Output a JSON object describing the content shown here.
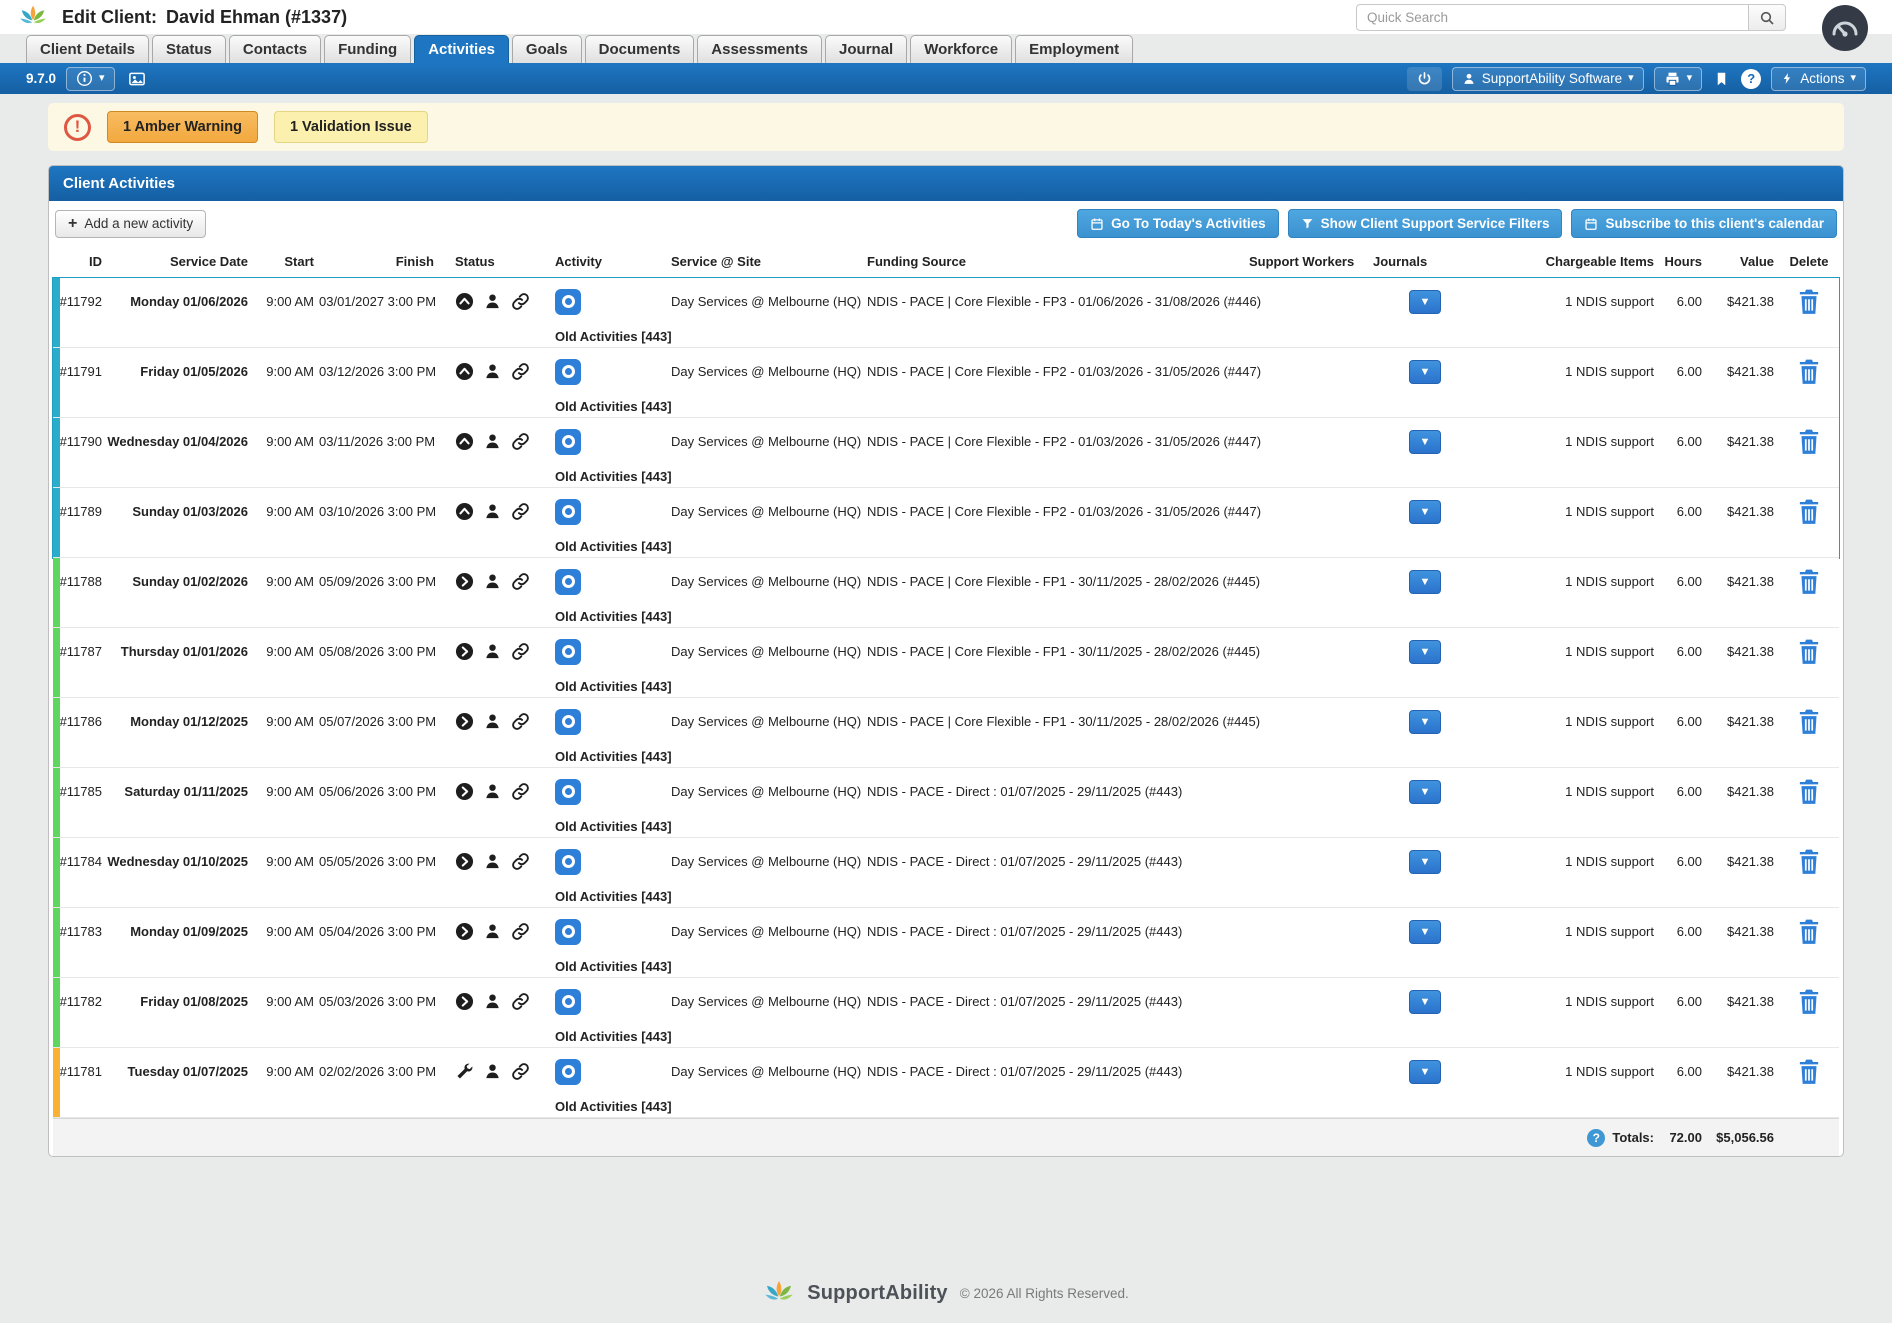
{
  "glyphs": {
    "caret_down": "▾",
    "dropdown_caret": "▼",
    "plus": "+",
    "question": "?",
    "exclamation": "!"
  },
  "header": {
    "title_prefix": "Edit Client:",
    "client_name": "David Ehman (#1337)",
    "search_placeholder": "Quick Search"
  },
  "tabs": [
    {
      "label": "Client Details",
      "active": false
    },
    {
      "label": "Status",
      "active": false
    },
    {
      "label": "Contacts",
      "active": false
    },
    {
      "label": "Funding",
      "active": false
    },
    {
      "label": "Activities",
      "active": true
    },
    {
      "label": "Goals",
      "active": false
    },
    {
      "label": "Documents",
      "active": false
    },
    {
      "label": "Assessments",
      "active": false
    },
    {
      "label": "Journal",
      "active": false
    },
    {
      "label": "Workforce",
      "active": false
    },
    {
      "label": "Employment",
      "active": false
    }
  ],
  "toolbar": {
    "version": "9.7.0",
    "user_menu_label": "SupportAbility Software",
    "actions_label": "Actions"
  },
  "warnings": {
    "amber_label": "1 Amber Warning",
    "validation_label": "1 Validation Issue"
  },
  "panel": {
    "title": "Client Activities",
    "add_button": "Add a new activity",
    "today_button": "Go To Today's Activities",
    "filters_button": "Show Client Support Service Filters",
    "subscribe_button": "Subscribe to this client's calendar"
  },
  "table": {
    "columns": [
      "ID",
      "Service Date",
      "Start",
      "Finish",
      "Status",
      "Activity",
      "Service @ Site",
      "Funding Source",
      "Support Workers",
      "Journals",
      "Chargeable Items",
      "Hours",
      "Value",
      "Delete"
    ],
    "rows": [
      {
        "id": "#11792",
        "date": "Monday 01/06/2026",
        "start": "9:00 AM",
        "finish": "03/01/2027 3:00 PM",
        "status_icon": "up",
        "activity_sub": "Old Activities [443]",
        "site": "Day Services @ Melbourne (HQ)",
        "funding": "NDIS - PACE | Core Flexible - FP3 - 01/06/2026 - 31/08/2026 (#446)",
        "chargeable": "1 NDIS support",
        "hours": "6.00",
        "value": "$421.38",
        "bar": "teal",
        "selected": true
      },
      {
        "id": "#11791",
        "date": "Friday 01/05/2026",
        "start": "9:00 AM",
        "finish": "03/12/2026 3:00 PM",
        "status_icon": "up",
        "activity_sub": "Old Activities [443]",
        "site": "Day Services @ Melbourne (HQ)",
        "funding": "NDIS - PACE | Core Flexible - FP2 - 01/03/2026 - 31/05/2026 (#447)",
        "chargeable": "1 NDIS support",
        "hours": "6.00",
        "value": "$421.38",
        "bar": "teal",
        "selected": true
      },
      {
        "id": "#11790",
        "date": "Wednesday 01/04/2026",
        "start": "9:00 AM",
        "finish": "03/11/2026 3:00 PM",
        "status_icon": "up",
        "activity_sub": "Old Activities [443]",
        "site": "Day Services @ Melbourne (HQ)",
        "funding": "NDIS - PACE | Core Flexible - FP2 - 01/03/2026 - 31/05/2026 (#447)",
        "chargeable": "1 NDIS support",
        "hours": "6.00",
        "value": "$421.38",
        "bar": "teal",
        "selected": true
      },
      {
        "id": "#11789",
        "date": "Sunday 01/03/2026",
        "start": "9:00 AM",
        "finish": "03/10/2026 3:00 PM",
        "status_icon": "up",
        "activity_sub": "Old Activities [443]",
        "site": "Day Services @ Melbourne (HQ)",
        "funding": "NDIS - PACE | Core Flexible - FP2 - 01/03/2026 - 31/05/2026 (#447)",
        "chargeable": "1 NDIS support",
        "hours": "6.00",
        "value": "$421.38",
        "bar": "teal",
        "selected": true
      },
      {
        "id": "#11788",
        "date": "Sunday 01/02/2026",
        "start": "9:00 AM",
        "finish": "05/09/2026 3:00 PM",
        "status_icon": "right",
        "activity_sub": "Old Activities [443]",
        "site": "Day Services @ Melbourne (HQ)",
        "funding": "NDIS - PACE | Core Flexible - FP1 - 30/11/2025 - 28/02/2026 (#445)",
        "chargeable": "1 NDIS support",
        "hours": "6.00",
        "value": "$421.38",
        "bar": "green",
        "selected": false
      },
      {
        "id": "#11787",
        "date": "Thursday 01/01/2026",
        "start": "9:00 AM",
        "finish": "05/08/2026 3:00 PM",
        "status_icon": "right",
        "activity_sub": "Old Activities [443]",
        "site": "Day Services @ Melbourne (HQ)",
        "funding": "NDIS - PACE | Core Flexible - FP1 - 30/11/2025 - 28/02/2026 (#445)",
        "chargeable": "1 NDIS support",
        "hours": "6.00",
        "value": "$421.38",
        "bar": "green",
        "selected": false
      },
      {
        "id": "#11786",
        "date": "Monday 01/12/2025",
        "start": "9:00 AM",
        "finish": "05/07/2026 3:00 PM",
        "status_icon": "right",
        "activity_sub": "Old Activities [443]",
        "site": "Day Services @ Melbourne (HQ)",
        "funding": "NDIS - PACE | Core Flexible - FP1 - 30/11/2025 - 28/02/2026 (#445)",
        "chargeable": "1 NDIS support",
        "hours": "6.00",
        "value": "$421.38",
        "bar": "green",
        "selected": false
      },
      {
        "id": "#11785",
        "date": "Saturday 01/11/2025",
        "start": "9:00 AM",
        "finish": "05/06/2026 3:00 PM",
        "status_icon": "right",
        "activity_sub": "Old Activities [443]",
        "site": "Day Services @ Melbourne (HQ)",
        "funding": "NDIS - PACE - Direct : 01/07/2025 - 29/11/2025 (#443)",
        "chargeable": "1 NDIS support",
        "hours": "6.00",
        "value": "$421.38",
        "bar": "green",
        "selected": false
      },
      {
        "id": "#11784",
        "date": "Wednesday 01/10/2025",
        "start": "9:00 AM",
        "finish": "05/05/2026 3:00 PM",
        "status_icon": "right",
        "activity_sub": "Old Activities [443]",
        "site": "Day Services @ Melbourne (HQ)",
        "funding": "NDIS - PACE - Direct : 01/07/2025 - 29/11/2025 (#443)",
        "chargeable": "1 NDIS support",
        "hours": "6.00",
        "value": "$421.38",
        "bar": "green",
        "selected": false
      },
      {
        "id": "#11783",
        "date": "Monday 01/09/2025",
        "start": "9:00 AM",
        "finish": "05/04/2026 3:00 PM",
        "status_icon": "right",
        "activity_sub": "Old Activities [443]",
        "site": "Day Services @ Melbourne (HQ)",
        "funding": "NDIS - PACE - Direct : 01/07/2025 - 29/11/2025 (#443)",
        "chargeable": "1 NDIS support",
        "hours": "6.00",
        "value": "$421.38",
        "bar": "green",
        "selected": false
      },
      {
        "id": "#11782",
        "date": "Friday 01/08/2025",
        "start": "9:00 AM",
        "finish": "05/03/2026 3:00 PM",
        "status_icon": "right",
        "activity_sub": "Old Activities [443]",
        "site": "Day Services @ Melbourne (HQ)",
        "funding": "NDIS - PACE - Direct : 01/07/2025 - 29/11/2025 (#443)",
        "chargeable": "1 NDIS support",
        "hours": "6.00",
        "value": "$421.38",
        "bar": "green",
        "selected": false
      },
      {
        "id": "#11781",
        "date": "Tuesday 01/07/2025",
        "start": "9:00 AM",
        "finish": "02/02/2026 3:00 PM",
        "status_icon": "wrench",
        "activity_sub": "Old Activities [443]",
        "site": "Day Services @ Melbourne (HQ)",
        "funding": "NDIS - PACE - Direct : 01/07/2025 - 29/11/2025 (#443)",
        "chargeable": "1 NDIS support",
        "hours": "6.00",
        "value": "$421.38",
        "bar": "orange",
        "selected": false
      }
    ],
    "totals_label": "Totals:",
    "totals_hours": "72.00",
    "totals_value": "$5,056.56"
  },
  "footer": {
    "brand": "SupportAbility",
    "copyright": "© 2026 All Rights Reserved."
  }
}
